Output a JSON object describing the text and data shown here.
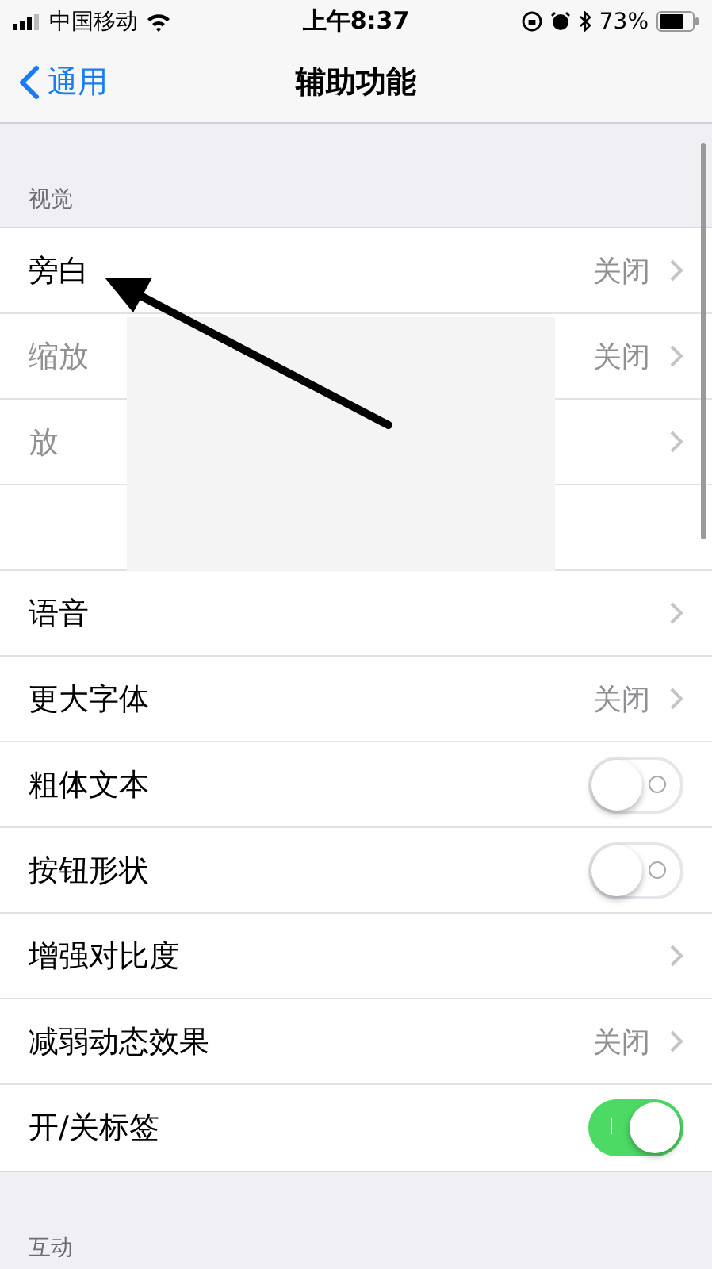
{
  "status_bar": {
    "carrier": "中国移动",
    "time": "上午8:37",
    "battery": "73%"
  },
  "nav": {
    "back": "通用",
    "title": "辅助功能"
  },
  "sections": [
    {
      "header": "视觉",
      "items": [
        {
          "kind": "link",
          "label": "旁白",
          "value": "关闭"
        },
        {
          "kind": "faded",
          "label": "缩放",
          "value": "关闭"
        },
        {
          "kind": "faded",
          "label": "放"
        },
        {
          "kind": "blank"
        },
        {
          "kind": "link",
          "label": "语音"
        },
        {
          "kind": "link",
          "label": "更大字体",
          "value": "关闭"
        },
        {
          "kind": "toggle",
          "label": "粗体文本",
          "on": false
        },
        {
          "kind": "toggle",
          "label": "按钮形状",
          "on": false
        },
        {
          "kind": "link",
          "label": "增强对比度"
        },
        {
          "kind": "link",
          "label": "减弱动态效果",
          "value": "关闭"
        },
        {
          "kind": "toggle",
          "label": "开/关标签",
          "on": true
        }
      ]
    },
    {
      "header": "互动"
    }
  ]
}
